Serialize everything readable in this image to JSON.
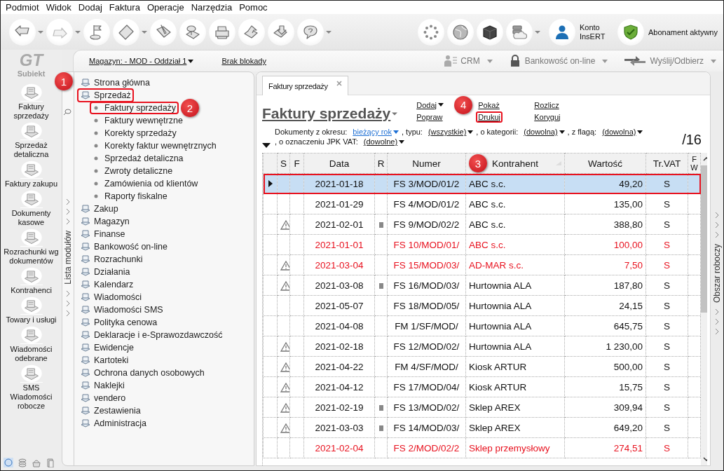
{
  "menu": [
    "Podmiot",
    "Widok",
    "Dodaj",
    "Faktura",
    "Operacje",
    "Narzędzia",
    "Pomoc"
  ],
  "toolbar": {
    "account": "Konto InsERT",
    "subscription": "Abonament aktywny"
  },
  "rail": {
    "logo_mark": "GT",
    "logo": "Subiekt",
    "items": [
      {
        "label": "Faktury sprzedaży"
      },
      {
        "label": "Sprzedaż detaliczna"
      },
      {
        "label": "Faktury zakupu"
      },
      {
        "label": "Dokumenty kasowe"
      },
      {
        "label": "Rozrachunki wg dokumentów"
      },
      {
        "label": "Kontrahenci"
      },
      {
        "label": "Towary i usługi"
      },
      {
        "label": "Wiadomości odebrane"
      },
      {
        "label": "SMS Wiadomości robocze"
      }
    ]
  },
  "context_bar": {
    "warehouse": "Magazyn: - MOD - Oddział 1",
    "lock": "Brak blokady",
    "actions": [
      {
        "label": "CRM"
      },
      {
        "label": "Bankowość on-line"
      },
      {
        "label": "Wyślij/Odbierz"
      }
    ]
  },
  "modules": {
    "strip_label": "Lista modułów",
    "items": [
      {
        "label": "Strona główna",
        "highlighted": false
      },
      {
        "label": "Sprzedaż",
        "expanded": true,
        "highlighted": true,
        "callout": "1",
        "children": [
          {
            "label": "Faktury sprzedaży",
            "highlighted": true,
            "callout": "2"
          },
          {
            "label": "Faktury wewnętrzne",
            "highlighted": false
          },
          {
            "label": "Korekty sprzedaży",
            "highlighted": false
          },
          {
            "label": "Korekty faktur wewnętrznych",
            "highlighted": false
          },
          {
            "label": "Sprzedaż detaliczna",
            "highlighted": false
          },
          {
            "label": "Zwroty detaliczne",
            "highlighted": false
          },
          {
            "label": "Zamówienia od klientów",
            "highlighted": false
          },
          {
            "label": "Raporty fiskalne",
            "highlighted": false
          }
        ]
      },
      {
        "label": "Zakup",
        "highlighted": false
      },
      {
        "label": "Magazyn",
        "highlighted": false
      },
      {
        "label": "Finanse",
        "highlighted": false
      },
      {
        "label": "Bankowość on-line",
        "highlighted": false
      },
      {
        "label": "Rozrachunki",
        "highlighted": false
      },
      {
        "label": "Działania",
        "highlighted": false
      },
      {
        "label": "Kalendarz",
        "highlighted": false
      },
      {
        "label": "Wiadomości",
        "highlighted": false
      },
      {
        "label": "Wiadomości SMS",
        "highlighted": false
      },
      {
        "label": "Polityka cenowa",
        "highlighted": false
      },
      {
        "label": "Deklaracje i e-Sprawozdawczość",
        "highlighted": false
      },
      {
        "label": "Ewidencje",
        "highlighted": false
      },
      {
        "label": "Kartoteki",
        "highlighted": false
      },
      {
        "label": "Ochrona danych osobowych",
        "highlighted": false
      },
      {
        "label": "Naklejki",
        "highlighted": false
      },
      {
        "label": "vendero",
        "highlighted": false
      },
      {
        "label": "Zestawienia",
        "highlighted": false
      },
      {
        "label": "Administracja",
        "highlighted": false
      }
    ]
  },
  "document_tab": {
    "label": "Faktury sprzedaży",
    "selected": true
  },
  "heading": "Faktury sprzedaży",
  "actions": [
    {
      "label": "Dodaj",
      "dropdown": true,
      "highlighted": false
    },
    {
      "label": "Pokaż",
      "dropdown": false,
      "highlighted": false
    },
    {
      "label": "Rozlicz",
      "dropdown": false,
      "highlighted": false
    },
    {
      "label": "Popraw",
      "dropdown": false,
      "highlighted": false
    },
    {
      "label": "Drukuj",
      "dropdown": false,
      "highlighted": true,
      "callout": "4"
    },
    {
      "label": "Koryguj",
      "dropdown": false,
      "highlighted": false
    }
  ],
  "filters": [
    {
      "label": "Dokumenty z okresu:",
      "value": "bieżący rok",
      "active": true
    },
    {
      "label": ", typu:",
      "value": "(wszystkie)",
      "active": false
    },
    {
      "label": ", o kategorii:",
      "value": "(dowolna)",
      "active": false
    },
    {
      "label": ", z flagą:",
      "value": "(dowolna)",
      "active": false
    },
    {
      "label": ", o oznaczeniu JPK VAT:",
      "value": "(dowolne)",
      "active": false
    }
  ],
  "count": "/16",
  "table": {
    "columns": [
      {
        "label": "S",
        "sorted": false
      },
      {
        "label": "F",
        "sorted": false
      },
      {
        "label": "Data",
        "sorted": false
      },
      {
        "label": "R",
        "sorted": false
      },
      {
        "label": "Numer",
        "sorted": false
      },
      {
        "label": "Kontrahent",
        "sorted": true,
        "callout": "3"
      },
      {
        "label": "Wartość",
        "sorted": false
      },
      {
        "label": "Tr.VAT",
        "sorted": false
      },
      {
        "label": "F W",
        "sorted": false
      }
    ],
    "rows": [
      {
        "selected": true,
        "highlighted": true,
        "red_text": false,
        "warning": false,
        "mark": false,
        "date": "2021-01-18",
        "number": "FS 3/MOD/01/2",
        "contractor": "ABC s.c.",
        "value": "49,20",
        "vat": "S"
      },
      {
        "selected": false,
        "highlighted": false,
        "red_text": false,
        "warning": false,
        "mark": false,
        "date": "2021-01-29",
        "number": "FS 4/MOD/01/2",
        "contractor": "ABC s.c.",
        "value": "135,00",
        "vat": "S"
      },
      {
        "selected": false,
        "highlighted": false,
        "red_text": false,
        "warning": true,
        "mark": true,
        "date": "2021-02-01",
        "number": "FS 9/MOD/02/2",
        "contractor": "ABC s.c.",
        "value": "388,80",
        "vat": "S"
      },
      {
        "selected": false,
        "highlighted": false,
        "red_text": true,
        "warning": false,
        "mark": false,
        "date": "2021-01-01",
        "number": "FS 10/MOD/01/",
        "contractor": "ABC s.c.",
        "value": "100,00",
        "vat": "S"
      },
      {
        "selected": false,
        "highlighted": false,
        "red_text": true,
        "warning": true,
        "mark": false,
        "date": "2021-03-04",
        "number": "FS 15/MOD/03/",
        "contractor": "AD-MAR s.c.",
        "value": "7,50",
        "vat": "S"
      },
      {
        "selected": false,
        "highlighted": false,
        "red_text": false,
        "warning": true,
        "mark": true,
        "date": "2021-03-08",
        "number": "FS 16/MOD/03/",
        "contractor": "Hurtownia ALA",
        "value": "187,80",
        "vat": "S"
      },
      {
        "selected": false,
        "highlighted": false,
        "red_text": false,
        "warning": false,
        "mark": false,
        "date": "2021-05-07",
        "number": "FS 18/MOD/05/",
        "contractor": "Hurtownia ALA",
        "value": "24,15",
        "vat": "S"
      },
      {
        "selected": false,
        "highlighted": false,
        "red_text": false,
        "warning": false,
        "mark": false,
        "date": "2021-04-08",
        "number": "FM 1/SF/MOD/",
        "contractor": "Hurtownia ALA",
        "value": "645,75",
        "vat": "S"
      },
      {
        "selected": false,
        "highlighted": false,
        "red_text": false,
        "warning": true,
        "mark": false,
        "date": "2021-02-18",
        "number": "FS 12/MOD/02/",
        "contractor": "Hurtownia ALA",
        "value": "1 230,00",
        "vat": "S"
      },
      {
        "selected": false,
        "highlighted": false,
        "red_text": false,
        "warning": true,
        "mark": false,
        "date": "2021-04-22",
        "number": "FM 4/SF/MOD/",
        "contractor": "Kiosk ARTUR",
        "value": "500,00",
        "vat": "S"
      },
      {
        "selected": false,
        "highlighted": false,
        "red_text": false,
        "warning": true,
        "mark": false,
        "date": "2021-04-12",
        "number": "FS 17/MOD/04/",
        "contractor": "Kiosk ARTUR",
        "value": "15,75",
        "vat": "S"
      },
      {
        "selected": false,
        "highlighted": false,
        "red_text": false,
        "warning": true,
        "mark": true,
        "date": "2021-02-19",
        "number": "FS 13/MOD/02/",
        "contractor": "Sklep AREX",
        "value": "309,94",
        "vat": "S"
      },
      {
        "selected": false,
        "highlighted": false,
        "red_text": false,
        "warning": true,
        "mark": true,
        "date": "2021-03-03",
        "number": "FS 14/MOD/03/",
        "contractor": "Sklep AREX",
        "value": "649,20",
        "vat": "S"
      },
      {
        "selected": false,
        "highlighted": false,
        "red_text": true,
        "warning": false,
        "mark": false,
        "date": "2021-02-04",
        "number": "FS 2/MOD/02/2",
        "contractor": "Sklep przemysłowy",
        "value": "274,51",
        "vat": "S"
      }
    ]
  },
  "side_panel": "Obszar roboczy"
}
